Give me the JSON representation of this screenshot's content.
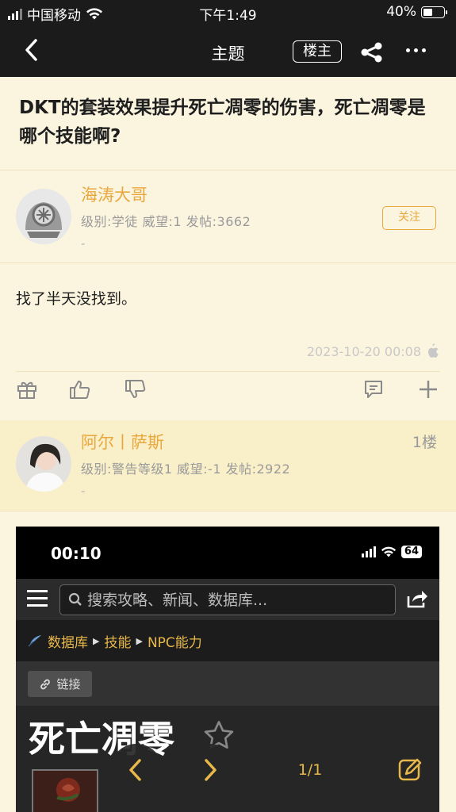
{
  "status_bar": {
    "carrier": "中国移动",
    "time": "下午1:49",
    "battery": "40%",
    "battery_level": 0.4
  },
  "nav": {
    "title": "主题",
    "op_badge": "楼主"
  },
  "post": {
    "title": "DKT的套装效果提升死亡凋零的伤害，死亡凋零是哪个技能啊?"
  },
  "author": {
    "name": "海涛大哥",
    "meta": "级别:学徒  威望:1  发帖:3662",
    "dash": "-",
    "follow": "关注"
  },
  "content": {
    "text": "找了半天没找到。",
    "timestamp": "2023-10-20 00:08"
  },
  "reply": {
    "name": "阿尔丨萨斯",
    "meta": "级别:警告等级1  威望:-1  发帖:2922",
    "dash": "-",
    "floor": "1楼"
  },
  "screenshot": {
    "time": "00:10",
    "battery": "64",
    "search_placeholder": "搜索攻略、新闻、数据库...",
    "crumbs": [
      "数据库",
      "技能",
      "NPC能力"
    ],
    "link_label": "链接",
    "skill_title": "死亡凋零"
  },
  "pager": {
    "label": "1/1"
  },
  "colors": {
    "accent": "#e9a83d",
    "background": "#fbf5e0",
    "topbar": "#1b1b1b",
    "reply_bg": "#f9efc9"
  }
}
